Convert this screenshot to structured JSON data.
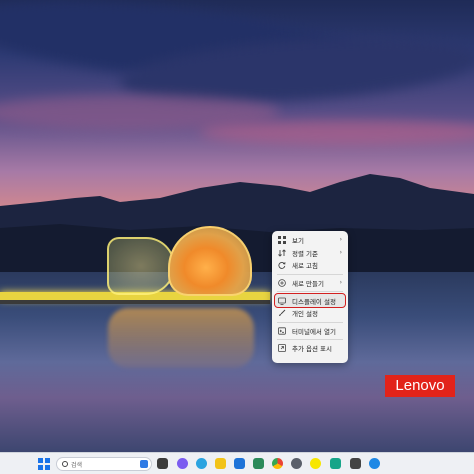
{
  "wallpaper": {
    "brand": "Lenovo",
    "brand_color": "#e2231a"
  },
  "context_menu": {
    "items": [
      {
        "label": "보기",
        "icon": "grid-view-icon",
        "submenu": true
      },
      {
        "label": "정렬 기준",
        "icon": "sort-icon",
        "submenu": true
      },
      {
        "label": "새로 고침",
        "icon": "refresh-icon",
        "submenu": false
      },
      {
        "label": "새로 만들기",
        "icon": "new-plus-icon",
        "submenu": true
      },
      {
        "label": "디스플레이 설정",
        "icon": "display-icon",
        "submenu": false,
        "highlighted": true
      },
      {
        "label": "개인 설정",
        "icon": "personalize-brush-icon",
        "submenu": false
      },
      {
        "label": "터미널에서 열기",
        "icon": "terminal-icon",
        "submenu": false
      },
      {
        "label": "추가 옵션 표시",
        "icon": "more-options-icon",
        "submenu": false
      }
    ],
    "submenu_glyph": "›",
    "highlight_color": "#d32020"
  },
  "taskbar": {
    "search_placeholder": "검색",
    "pinned_apps": [
      "widgets-icon",
      "chat-icon",
      "edge-icon",
      "file-explorer-icon",
      "mail-icon",
      "store-icon",
      "chrome-icon",
      "settings-icon",
      "kakaotalk-icon",
      "notes-icon",
      "photos-icon",
      "app-icon"
    ]
  }
}
